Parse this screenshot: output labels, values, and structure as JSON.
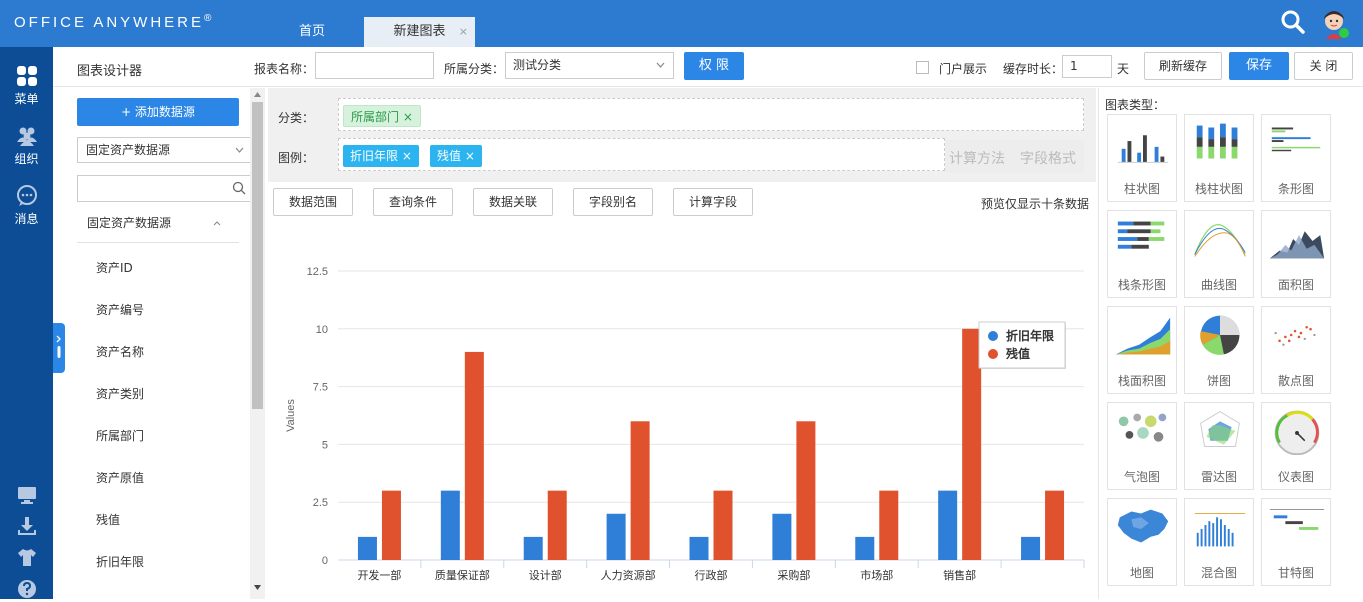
{
  "app": {
    "logo": "Office Anywhere",
    "logo_mark": "®"
  },
  "tabs": [
    {
      "label": "首页"
    },
    {
      "label": "新建图表",
      "close": "×"
    }
  ],
  "left_nav": [
    {
      "label": "菜单",
      "icon": "grid-icon"
    },
    {
      "label": "组织",
      "icon": "users-icon"
    },
    {
      "label": "消息",
      "icon": "chat-icon"
    }
  ],
  "toolbar": {
    "title": "图表设计器",
    "report_name_label": "报表名称：",
    "report_name_value": "",
    "category_label": "所属分类：",
    "category_value": "测试分类",
    "permission_button": "权 限",
    "portal_label": "门户展示",
    "cache_label": "缓存时长：",
    "cache_value": "1",
    "cache_unit": "天",
    "refresh_button": "刷新缓存",
    "save_button": "保存",
    "close_button": "关 闭"
  },
  "datasource": {
    "add_button": "+ 添加数据源",
    "selected": "固定资产数据源",
    "search_value": "",
    "group_label": "固定资产数据源",
    "fields": [
      "资产ID",
      "资产编号",
      "资产名称",
      "资产类别",
      "所属部门",
      "资产原值",
      "残值",
      "折旧年限"
    ]
  },
  "drop": {
    "category_label": "分类：",
    "category_tags": [
      "所属部门"
    ],
    "legend_label": "图例：",
    "legend_tags": [
      "折旧年限",
      "残值"
    ],
    "tag_close": "×",
    "calc_method": "计算方法",
    "field_format": "字段格式"
  },
  "sub_buttons": [
    "数据范围",
    "查询条件",
    "数据关联",
    "字段别名",
    "计算字段"
  ],
  "preview_note": "预览仅显示十条数据",
  "chart_data": {
    "type": "bar",
    "categories": [
      "开发一部",
      "质量保证部",
      "设计部",
      "人力资源部",
      "行政部",
      "采购部",
      "市场部",
      "销售部",
      ""
    ],
    "series": [
      {
        "name": "折旧年限",
        "color": "#2f7ed8",
        "values": [
          1,
          3,
          1,
          2,
          1,
          2,
          1,
          3,
          1
        ]
      },
      {
        "name": "残值",
        "color": "#e0512d",
        "values": [
          3,
          9,
          3,
          6,
          3,
          6,
          3,
          10,
          3
        ]
      }
    ],
    "ylabel": "Values",
    "ylim": [
      0,
      12.5
    ],
    "yticks": [
      "0",
      "2.5",
      "5",
      "7.5",
      "10",
      "12.5"
    ],
    "grid": true,
    "legend_position": "top-right"
  },
  "chart_types": {
    "title": "图表类型：",
    "items": [
      {
        "label": "柱状图",
        "icon": "bar-chart-icon"
      },
      {
        "label": "栈柱状图",
        "icon": "stacked-bar-chart-icon"
      },
      {
        "label": "条形图",
        "icon": "horizontal-bar-chart-icon"
      },
      {
        "label": "栈条形图",
        "icon": "stacked-horizontal-bar-icon"
      },
      {
        "label": "曲线图",
        "icon": "line-chart-icon"
      },
      {
        "label": "面积图",
        "icon": "area-chart-icon"
      },
      {
        "label": "栈面积图",
        "icon": "stacked-area-chart-icon"
      },
      {
        "label": "饼图",
        "icon": "pie-chart-icon"
      },
      {
        "label": "散点图",
        "icon": "scatter-chart-icon"
      },
      {
        "label": "气泡图",
        "icon": "bubble-chart-icon"
      },
      {
        "label": "雷达图",
        "icon": "radar-chart-icon"
      },
      {
        "label": "仪表图",
        "icon": "gauge-chart-icon"
      },
      {
        "label": "地图",
        "icon": "map-chart-icon"
      },
      {
        "label": "混合图",
        "icon": "mixed-chart-icon"
      },
      {
        "label": "甘特图",
        "icon": "gantt-chart-icon"
      }
    ]
  }
}
